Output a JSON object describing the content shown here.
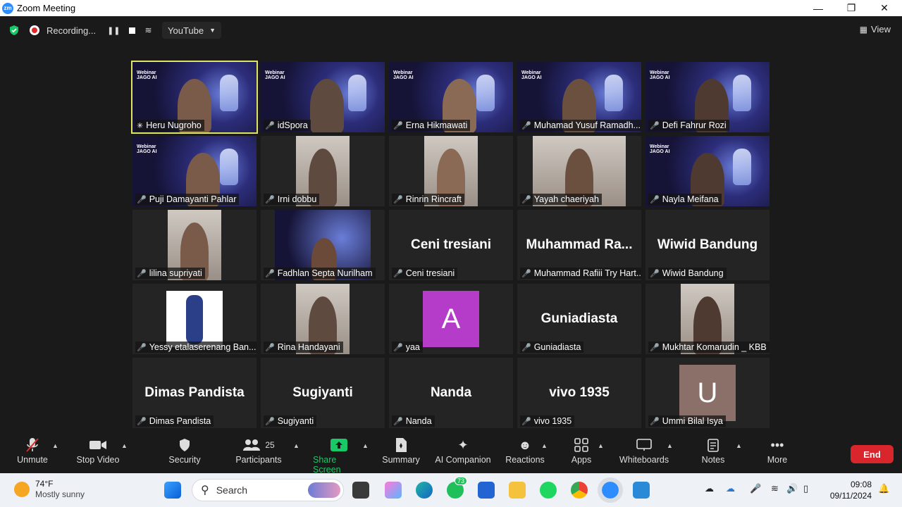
{
  "window": {
    "title": "Zoom Meeting",
    "app_icon": "zm"
  },
  "topbar": {
    "recording_label": "Recording...",
    "stream_target": "YouTube",
    "view_label": "View"
  },
  "participants": [
    {
      "name": "Heru Nugroho",
      "display": "",
      "type": "video-webinar",
      "active": true,
      "muted": false
    },
    {
      "name": "idSpora",
      "display": "",
      "type": "video-webinar",
      "active": false,
      "muted": true
    },
    {
      "name": "Erna Hikmawati",
      "display": "",
      "type": "video-webinar",
      "active": false,
      "muted": true
    },
    {
      "name": "Muhamad Yusuf Ramadh...",
      "display": "",
      "type": "video-webinar",
      "active": false,
      "muted": true
    },
    {
      "name": "Defi Fahrur Rozi",
      "display": "",
      "type": "video-webinar",
      "active": false,
      "muted": true
    },
    {
      "name": "Puji Damayanti Pahlar",
      "display": "",
      "type": "video-webinar",
      "active": false,
      "muted": true
    },
    {
      "name": "Irni dobbu",
      "display": "",
      "type": "video-photo",
      "active": false,
      "muted": true
    },
    {
      "name": "Rinrin Rincraft",
      "display": "",
      "type": "video-photo",
      "active": false,
      "muted": true
    },
    {
      "name": "Yayah chaeriyah",
      "display": "",
      "type": "video-photo",
      "active": false,
      "muted": true
    },
    {
      "name": "Nayla Meifana",
      "display": "",
      "type": "video-webinar",
      "active": false,
      "muted": true
    },
    {
      "name": "lilina supriyati",
      "display": "",
      "type": "video-photo",
      "active": false,
      "muted": true
    },
    {
      "name": "Fadhlan Septa Nurilham",
      "display": "",
      "type": "video-webinar-small",
      "active": false,
      "muted": true
    },
    {
      "name": "Ceni tresiani",
      "display": "Ceni tresiani",
      "type": "text",
      "active": false,
      "muted": true
    },
    {
      "name": "Muhammad Rafiii Try Hart...",
      "display": "Muhammad  Ra...",
      "type": "text",
      "active": false,
      "muted": true
    },
    {
      "name": "Wiwid  Bandung",
      "display": "Wiwid  Bandung",
      "type": "text",
      "active": false,
      "muted": true
    },
    {
      "name": "Yessy etalaserenang Ban...",
      "display": "",
      "type": "video-photo-white",
      "active": false,
      "muted": true
    },
    {
      "name": "Rina Handayani",
      "display": "",
      "type": "video-photo",
      "active": false,
      "muted": true
    },
    {
      "name": "yaa",
      "display": "A",
      "type": "avatar",
      "avatar_color": "#b43cc8",
      "active": false,
      "muted": true
    },
    {
      "name": "Guniadiasta",
      "display": "Guniadiasta",
      "type": "text",
      "active": false,
      "muted": true
    },
    {
      "name": "Mukhtar Komarudin _ KBB",
      "display": "",
      "type": "video-photo",
      "active": false,
      "muted": true
    },
    {
      "name": "Dimas Pandista",
      "display": "Dimas Pandista",
      "type": "text",
      "active": false,
      "muted": true
    },
    {
      "name": "Sugiyanti",
      "display": "Sugiyanti",
      "type": "text",
      "active": false,
      "muted": true
    },
    {
      "name": "Nanda",
      "display": "Nanda",
      "type": "text",
      "active": false,
      "muted": true
    },
    {
      "name": "vivo 1935",
      "display": "vivo 1935",
      "type": "text",
      "active": false,
      "muted": true
    },
    {
      "name": "Ummi Bilal Isya",
      "display": "U",
      "type": "avatar",
      "avatar_color": "#8a7068",
      "active": false,
      "muted": true
    }
  ],
  "toolbar": {
    "unmute": "Unmute",
    "stop_video": "Stop Video",
    "security": "Security",
    "participants": "Participants",
    "participants_count": "25",
    "share_screen": "Share Screen",
    "summary": "Summary",
    "ai_companion": "AI Companion",
    "reactions": "Reactions",
    "apps": "Apps",
    "whiteboards": "Whiteboards",
    "notes": "Notes",
    "more": "More",
    "end": "End"
  },
  "taskbar": {
    "temperature": "74°F",
    "weather": "Mostly sunny",
    "search_placeholder": "Search",
    "whatsapp_badge": "73",
    "time": "09:08",
    "date": "09/11/2024"
  },
  "colors": {
    "active_speaker": "#dfe464",
    "share_green": "#19c866",
    "end_red": "#d9262c",
    "muted_red": "#e02828"
  }
}
